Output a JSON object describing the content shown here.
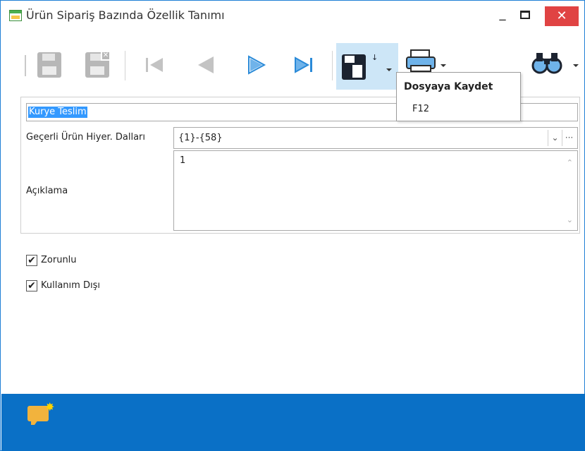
{
  "window": {
    "title": "Ürün Sipariş Bazında Özellik Tanımı",
    "minimize_glyph": "_",
    "close_glyph": "✕",
    "accent_color": "#0a70c6",
    "close_color": "#e04343"
  },
  "toolbar": {
    "buttons": [
      {
        "icon": "save-disk-icon",
        "state": "disabled"
      },
      {
        "icon": "delete-disk-icon",
        "state": "disabled"
      },
      {
        "icon": "first-record-icon",
        "state": "disabled"
      },
      {
        "icon": "previous-record-icon",
        "state": "disabled"
      },
      {
        "icon": "next-record-icon",
        "state": "enabled"
      },
      {
        "icon": "last-record-icon",
        "state": "enabled"
      },
      {
        "icon": "save-to-file-icon",
        "state": "hover"
      },
      {
        "icon": "print-icon",
        "state": "enabled"
      },
      {
        "icon": "binoculars-search-icon",
        "state": "enabled"
      }
    ]
  },
  "tooltip": {
    "title": "Dosyaya Kaydet",
    "shortcut": "F12"
  },
  "form": {
    "name_value": "Kurye Teslim",
    "hierarchy_label": "Geçerli Ürün Hiyer. Dalları",
    "hierarchy_value": "{1}-{58}",
    "ellipsis": "···",
    "description_label": "Açıklama",
    "description_value": "1"
  },
  "options": {
    "required_label": "Zorunlu",
    "required_checked": true,
    "disabled_label": "Kullanım Dışı",
    "disabled_checked": true,
    "check_glyph": "✔"
  }
}
